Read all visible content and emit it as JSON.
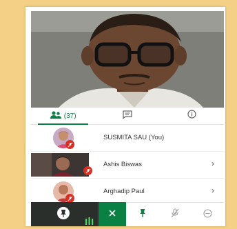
{
  "tabs": {
    "participants_count": "(37)"
  },
  "participants": [
    {
      "name": "SUSMITA SAU (You)",
      "muted": true
    },
    {
      "name": "Ashis Biswas",
      "muted": true
    },
    {
      "name": "Arghadip Paul",
      "muted": true
    }
  ],
  "colors": {
    "accent": "#0b8043",
    "muted_badge": "#d93025",
    "background": "#f4cf86"
  },
  "icons": {
    "participants_tab": "people-icon",
    "chat_tab": "chat-icon",
    "info_tab": "info-icon",
    "row_chevron": "chevron-right-icon",
    "controls": [
      "pin-icon",
      "audio-level-icon",
      "close-icon",
      "pin-icon",
      "mic-off-icon",
      "remove-icon"
    ]
  }
}
